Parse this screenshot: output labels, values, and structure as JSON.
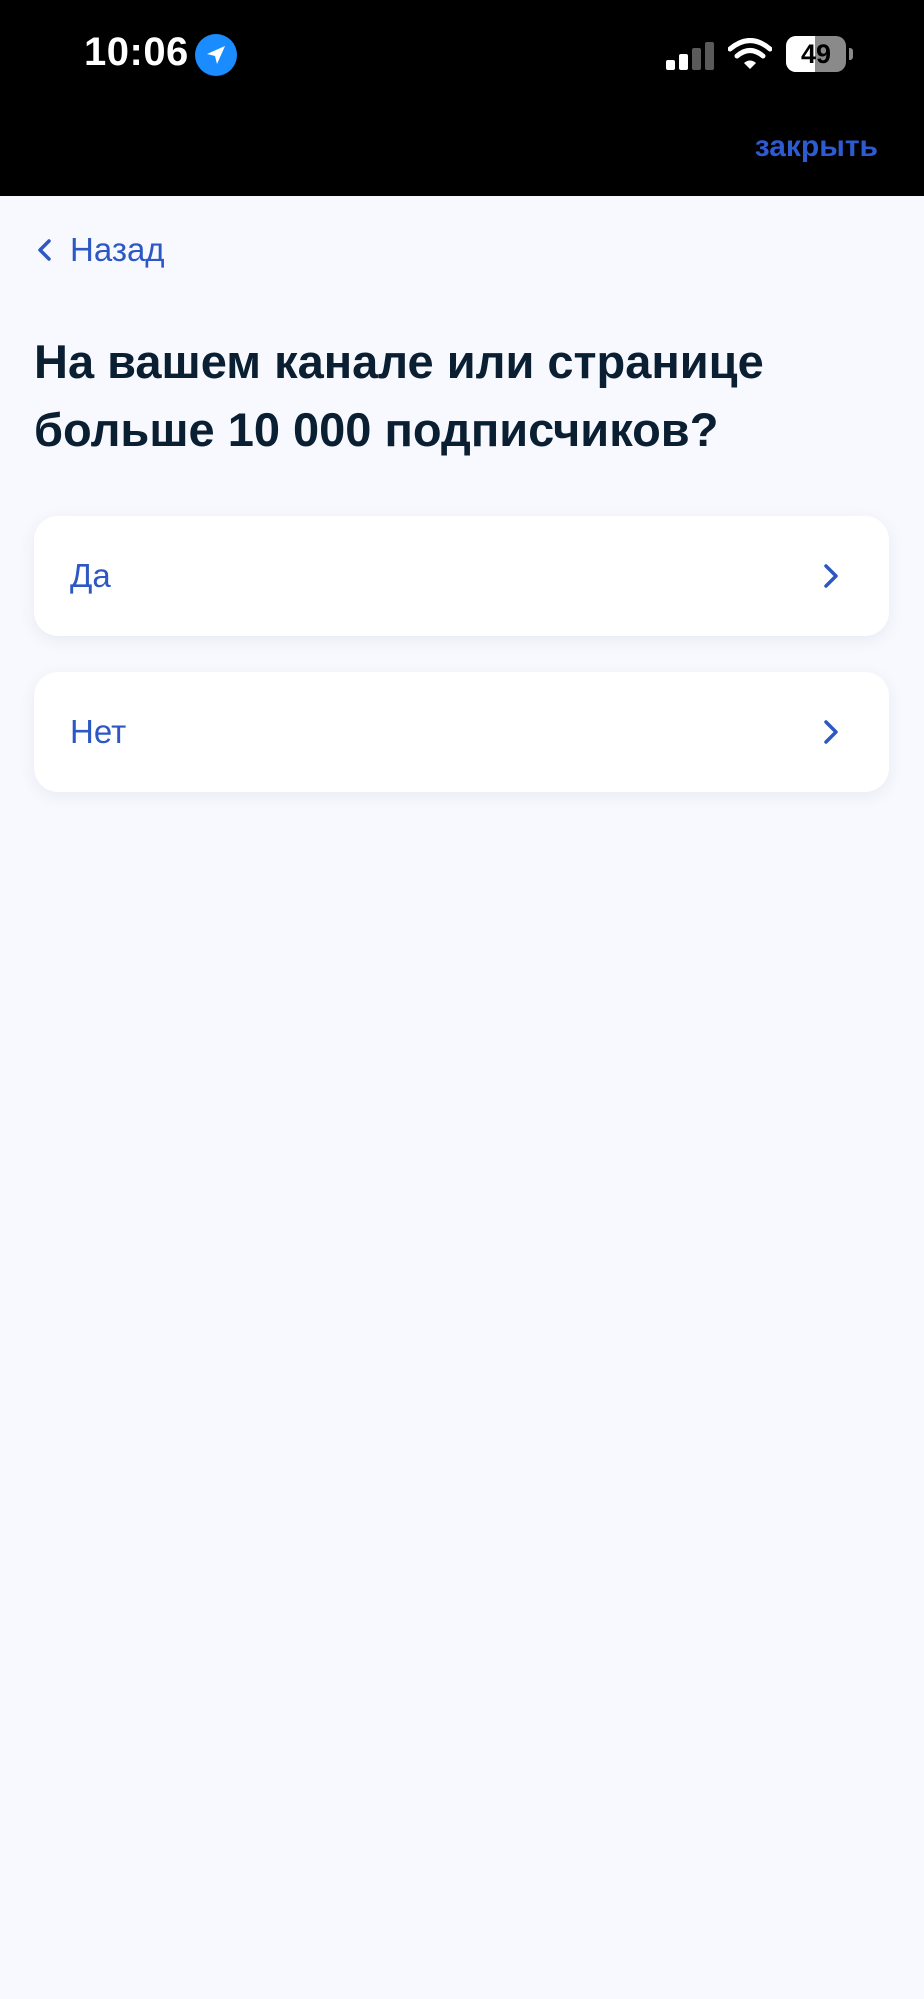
{
  "status_bar": {
    "time": "10:06",
    "battery_level": "49",
    "battery_fraction": 0.49,
    "signal_bars_active": 2,
    "signal_bars_total": 4,
    "icons": [
      "location-arrow-icon",
      "cellular-signal-icon",
      "wifi-icon",
      "battery-icon"
    ]
  },
  "header": {
    "close_label": "закрыть"
  },
  "navigation": {
    "back_label": "Назад",
    "back_icon": "chevron-left-icon"
  },
  "question": {
    "title": "На вашем канале или странице больше 10 000 подписчиков?"
  },
  "options": [
    {
      "label": "Да",
      "icon": "chevron-right-icon"
    },
    {
      "label": "Нет",
      "icon": "chevron-right-icon"
    }
  ],
  "colors": {
    "accent": "#2d58c4",
    "title_text": "#0b1f33",
    "page_background": "#f8f9fe",
    "card_background": "#ffffff",
    "status_bar_background": "#000000",
    "location_badge": "#1a8cff"
  }
}
